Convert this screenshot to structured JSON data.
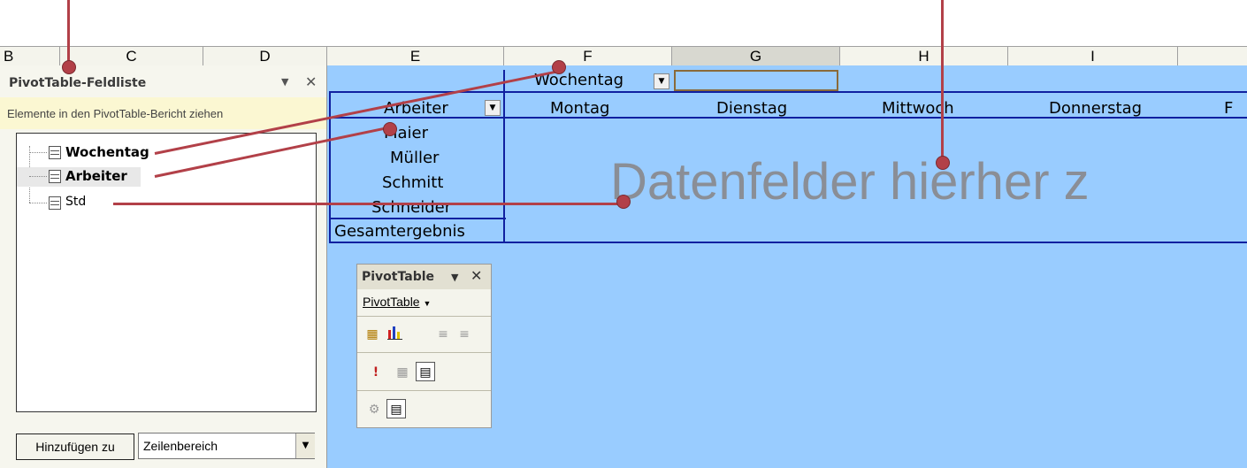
{
  "columns": [
    {
      "id": "B",
      "label": "B"
    },
    {
      "id": "C",
      "label": "C"
    },
    {
      "id": "D",
      "label": "D"
    },
    {
      "id": "E",
      "label": "E"
    },
    {
      "id": "F",
      "label": "F"
    },
    {
      "id": "G",
      "label": "G"
    },
    {
      "id": "H",
      "label": "H"
    },
    {
      "id": "I",
      "label": "I"
    }
  ],
  "field_list": {
    "title": "PivotTable-Feldliste",
    "hint": "Elemente in den PivotTable-Bericht ziehen",
    "fields": [
      {
        "label": "Wochentag",
        "bold": true
      },
      {
        "label": "Arbeiter",
        "bold": true
      },
      {
        "label": "Std",
        "bold": false
      }
    ],
    "add_button": "Hinzufügen zu",
    "area_select_value": "Zeilenbereich"
  },
  "pivot": {
    "page_field": "Wochentag",
    "row_field": "Arbeiter",
    "columns": [
      "Montag",
      "Dienstag",
      "Mittwoch",
      "Donnerstag",
      "F"
    ],
    "rows": [
      "Maier",
      "Müller",
      "Schmitt",
      "Schneider"
    ],
    "total_label": "Gesamtergebnis",
    "data_placeholder": "Datenfelder hierher z"
  },
  "toolbar": {
    "title": "PivotTable",
    "menu_label": "PivotTable",
    "icons": [
      "format-report-icon",
      "chart-wizard-icon",
      "hide-detail-icon",
      "show-detail-icon",
      "refresh-icon",
      "include-hidden-icon",
      "always-display-items-icon",
      "field-settings-icon",
      "field-list-icon"
    ]
  },
  "colors": {
    "sheet_background": "#99ccff",
    "pivot_border": "#1020a0",
    "callout": "#b24048",
    "hint_background": "#fbf7d2"
  }
}
